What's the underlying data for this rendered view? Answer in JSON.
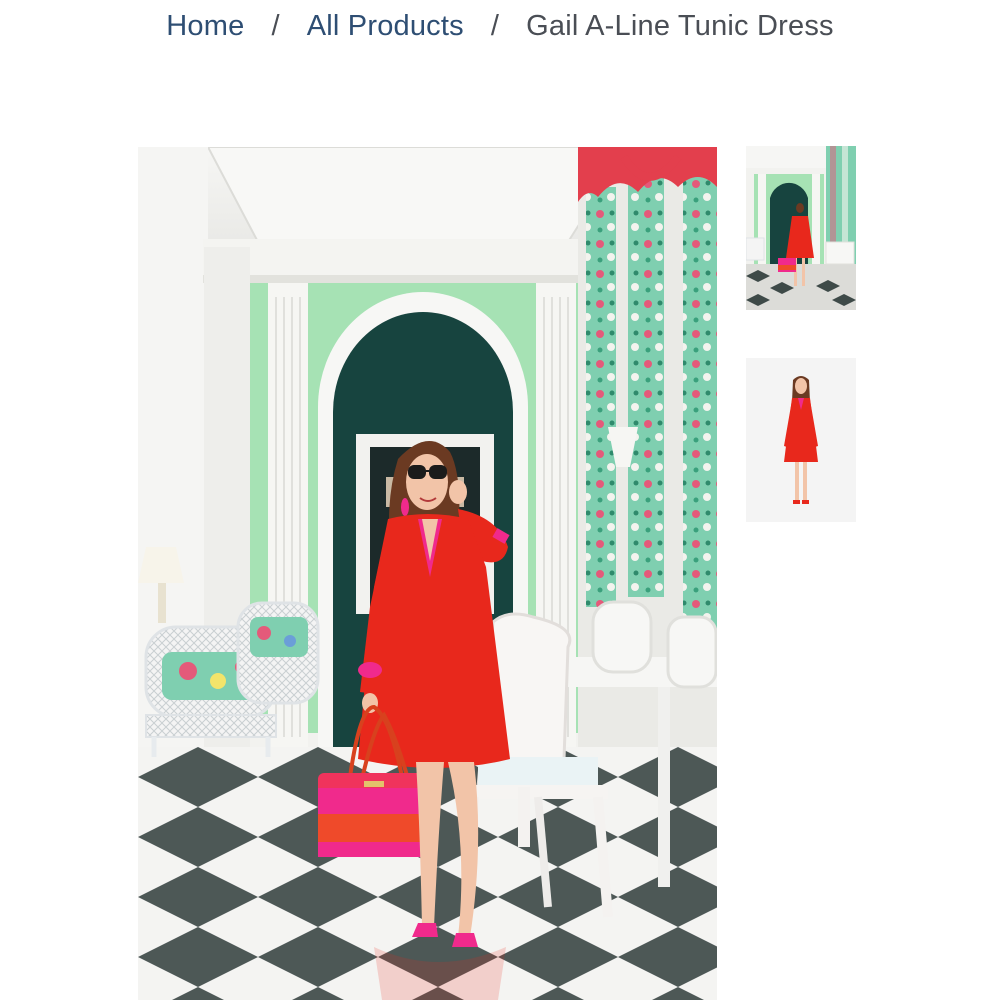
{
  "breadcrumb": {
    "home": "Home",
    "separator": "/",
    "category": "All Products",
    "current": "Gail A-Line Tunic Dress"
  },
  "colors": {
    "link": "#2e4e73",
    "current_text": "#4a4e55",
    "dress_red": "#e8281c",
    "accent_pink": "#f02a8c",
    "mint_wall": "#a6e2b4",
    "archway_teal": "#17443f"
  },
  "gallery": {
    "main_image": "lifestyle-photo",
    "thumbnails": [
      {
        "image": "lifestyle-photo",
        "selected": true
      },
      {
        "image": "studio-photo",
        "selected": false
      }
    ]
  }
}
